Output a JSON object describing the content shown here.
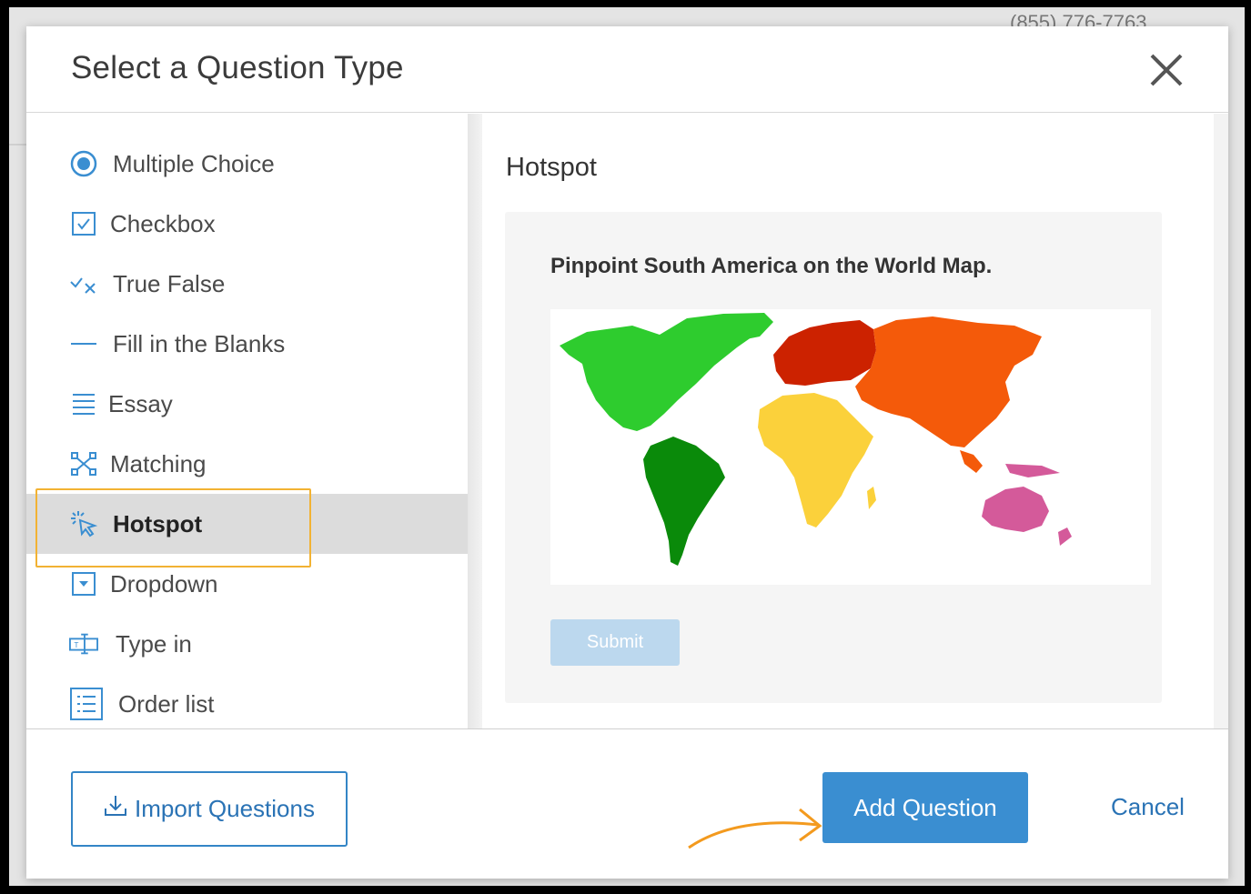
{
  "background": {
    "phone": "(855) 776-7763"
  },
  "modal": {
    "title": "Select a Question Type",
    "close_icon": "close-icon"
  },
  "sidebar": {
    "items": [
      {
        "label": "Multiple Choice",
        "icon": "radio-icon",
        "active": false
      },
      {
        "label": "Checkbox",
        "icon": "checkbox-icon",
        "active": false
      },
      {
        "label": "True False",
        "icon": "true-false-icon",
        "active": false
      },
      {
        "label": "Fill in the Blanks",
        "icon": "dash-icon",
        "active": false
      },
      {
        "label": "Essay",
        "icon": "lines-icon",
        "active": false
      },
      {
        "label": "Matching",
        "icon": "matching-icon",
        "active": false
      },
      {
        "label": "Hotspot",
        "icon": "hotspot-cursor-icon",
        "active": true
      },
      {
        "label": "Dropdown",
        "icon": "dropdown-icon",
        "active": false
      },
      {
        "label": "Type in",
        "icon": "type-in-icon",
        "active": false
      },
      {
        "label": "Order list",
        "icon": "order-list-icon",
        "active": false
      }
    ]
  },
  "preview": {
    "title": "Hotspot",
    "question": "Pinpoint South America on the World Map.",
    "submit_label": "Submit",
    "map_colors": {
      "north_america": "#2ecc2e",
      "south_america": "#0a8a0a",
      "europe": "#cc2200",
      "africa": "#fbd13b",
      "asia": "#f45a0a",
      "oceania": "#d45a9a"
    }
  },
  "footer": {
    "import_label": "Import Questions",
    "add_label": "Add Question",
    "cancel_label": "Cancel"
  },
  "colors": {
    "accent": "#3a8ed1",
    "highlight": "#f2b233",
    "arrow": "#f39a1e"
  }
}
